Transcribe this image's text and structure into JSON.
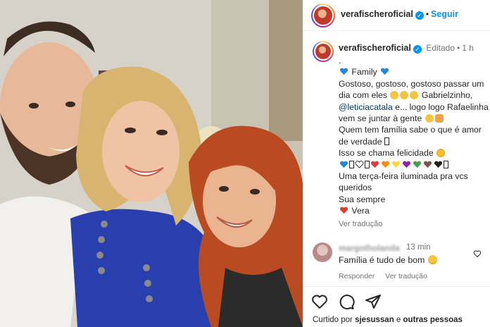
{
  "post": {
    "image_alt": "Selfie of three people smiling",
    "author": "verafischeroficial",
    "follow_label": "Seguir",
    "edited_label": "Editado",
    "time_ago": "1 h"
  },
  "caption": {
    "lines": [
      ".",
      "Family",
      "Gostoso, gostoso, gostoso passar um",
      "dia com eles",
      "Gabrielzinho,",
      "@leticiacatala",
      "e... logo logo Rafaelinha",
      "vem se juntar à gente",
      "Quem tem família sabe o que é amor",
      "de verdade",
      "Isso se chama felicidade",
      "Uma terça-feira iluminada pra vcs",
      "queridos",
      "Sua sempre",
      "Vera"
    ],
    "translate_label": "Ver tradução"
  },
  "comment": {
    "username": "margotholanda",
    "time_ago": "13 min",
    "text": "Família é tudo de bom",
    "reply_label": "Responder",
    "translate_label": "Ver tradução"
  },
  "likes": {
    "prefix": "Curtido por",
    "user": "sjesussan",
    "joiner": "e",
    "others": "outras pessoas"
  },
  "icons": {
    "like": "heart-icon",
    "comment": "comment-icon",
    "share": "share-icon",
    "verified": "verified-badge-icon"
  },
  "colors": {
    "accent_blue": "#0095f6",
    "mention": "#00376b",
    "muted": "#737373"
  }
}
